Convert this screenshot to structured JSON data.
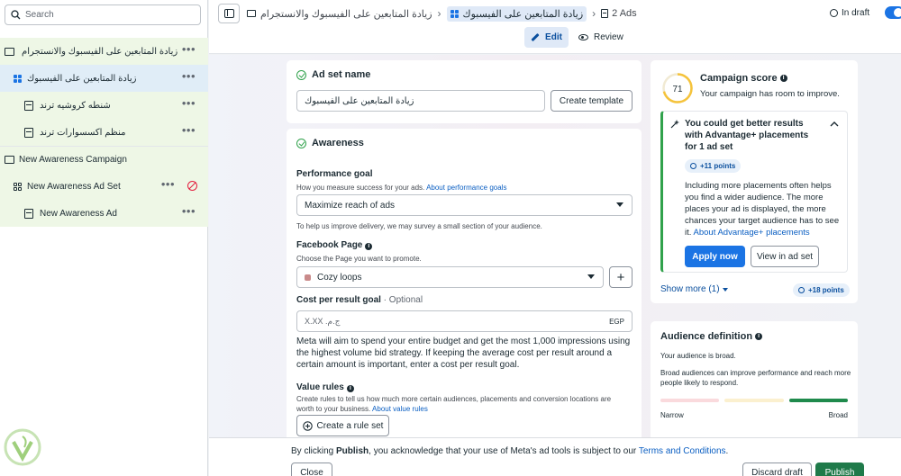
{
  "sidebar": {
    "search_placeholder": "Search",
    "items": [
      {
        "label": "زيادة المتابعين على الفيسبوك والانستجرام"
      },
      {
        "label": "زيادة المتابعين على الفيسبوك"
      },
      {
        "label": "شنطه كروشيه ترند"
      },
      {
        "label": "منظم اكسسوارات ترند"
      },
      {
        "label": "New Awareness Campaign"
      },
      {
        "label": "New Awareness Ad Set"
      },
      {
        "label": "New Awareness Ad"
      }
    ]
  },
  "header": {
    "crumbs": [
      "زيادة المتابعين على الفيسبوك والانستجرام",
      "زيادة المتابعين على الفيسبوك",
      "2 Ads"
    ],
    "status": "In draft",
    "tabs": {
      "edit": "Edit",
      "review": "Review"
    }
  },
  "adset": {
    "title": "Ad set name",
    "name_value": "زيادة المتابعين على الفيسبوك",
    "create_template": "Create template"
  },
  "awareness": {
    "title": "Awareness",
    "goal_label": "Performance goal",
    "goal_help": "How you measure success for your ads.",
    "goal_help_link": "About performance goals",
    "goal_value": "Maximize reach of ads",
    "goal_note": "To help us improve delivery, we may survey a small section of your audience.",
    "page_label": "Facebook Page",
    "page_help": "Choose the Page you want to promote.",
    "page_value": "Cozy loops",
    "page_add": "+",
    "cost_label": "Cost per result goal",
    "cost_optional": " · Optional",
    "cost_placeholder": "X.XX ج.م.‏",
    "cost_currency": "EGP",
    "cost_desc": "Meta will aim to spend your entire budget and get the most 1,000 impressions using the highest volume bid strategy. If keeping the average cost per result around a certain amount is important, enter a cost per result goal.",
    "value_label": "Value rules",
    "value_help": "Create rules to tell us how much more certain audiences, placements and conversion locations are worth to your business.",
    "value_help_link": "About value rules",
    "value_button": "Create a rule set"
  },
  "score": {
    "title": "Campaign score",
    "value": "71",
    "subtitle": "Your campaign has room to improve.",
    "rec_title": "You could get better results with Advantage+ placements for 1 ad set",
    "rec_points": "+11 points",
    "rec_body": "Including more placements often helps you find a wider audience. The more places your ad is displayed, the more chances your target audience has to see it.",
    "rec_link": "About Advantage+ placements",
    "apply": "Apply now",
    "view": "View in ad set",
    "show_more": "Show more (1)",
    "more_points": "+18 points",
    "progress": 0.71,
    "accent": "#f5c33b"
  },
  "audience": {
    "title": "Audience definition",
    "status": "Your audience is broad.",
    "desc": "Broad audiences can improve performance and reach more people likely to respond.",
    "narrow": "Narrow",
    "broad": "Broad"
  },
  "footer": {
    "consent_pre": "By clicking ",
    "consent_bold": "Publish",
    "consent_mid": ", you acknowledge that your use of Meta's ad tools is subject to our ",
    "consent_link": "Terms and Conditions",
    "consent_end": ".",
    "close": "Close",
    "discard": "Discard draft",
    "publish": "Publish"
  }
}
